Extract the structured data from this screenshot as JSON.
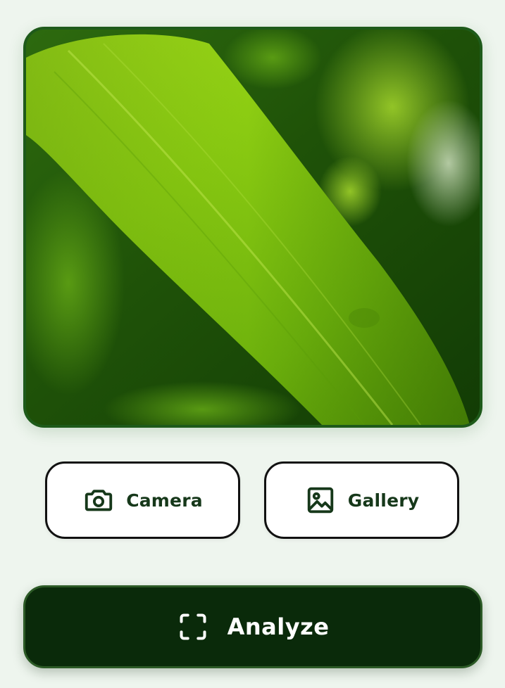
{
  "preview": {
    "image_alt": "Green leaf photo"
  },
  "actions": {
    "camera": {
      "label": "Camera",
      "icon": "camera-icon"
    },
    "gallery": {
      "label": "Gallery",
      "icon": "image-icon"
    }
  },
  "analyze": {
    "label": "Analyze",
    "icon": "scan-frame-icon"
  },
  "colors": {
    "background": "#eef5ee",
    "frame_border": "#1e5a1a",
    "primary_dark": "#0a2a0a",
    "icon_green": "#16381a"
  }
}
